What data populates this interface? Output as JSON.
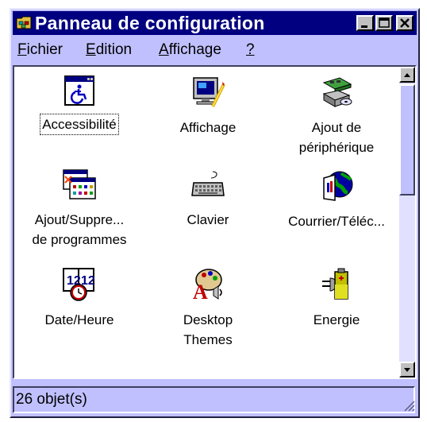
{
  "window": {
    "title": "Panneau de configuration",
    "app_icon": "control-panel-folder-icon",
    "controls": [
      "minimize-icon",
      "maximize-icon",
      "close-icon"
    ]
  },
  "menu": [
    {
      "label": "Fichier",
      "mnemonic": "F",
      "rest": "ichier"
    },
    {
      "label": "Edition",
      "mnemonic": "E",
      "rest": "dition"
    },
    {
      "label": "Affichage",
      "mnemonic": "A",
      "rest": "ffichage"
    },
    {
      "label": "?",
      "mnemonic": "?",
      "rest": ""
    }
  ],
  "items": [
    {
      "label": "Accessibilité",
      "icon": "accessibility-icon",
      "selected": true
    },
    {
      "label": "Affichage",
      "icon": "display-monitor-icon",
      "selected": false
    },
    {
      "label": "Ajout de\npériphérique",
      "icon": "add-hardware-icon",
      "selected": false
    },
    {
      "label": "Ajout/Suppre...\nde programmes",
      "icon": "add-remove-programs-icon",
      "selected": false
    },
    {
      "label": "Clavier",
      "icon": "keyboard-icon",
      "selected": false
    },
    {
      "label": "Courrier/Téléc...",
      "icon": "mail-fax-icon",
      "selected": false
    },
    {
      "label": "Date/Heure",
      "icon": "date-time-icon",
      "selected": false
    },
    {
      "label": "Desktop\nThemes",
      "icon": "desktop-themes-icon",
      "selected": false
    },
    {
      "label": "Energie",
      "icon": "power-battery-icon",
      "selected": false
    }
  ],
  "status": {
    "count_text": "26 objet(s)"
  },
  "colors": {
    "titlebar": "#000080",
    "window_face": "#c0c0ff",
    "client_bg": "#ffffff"
  }
}
